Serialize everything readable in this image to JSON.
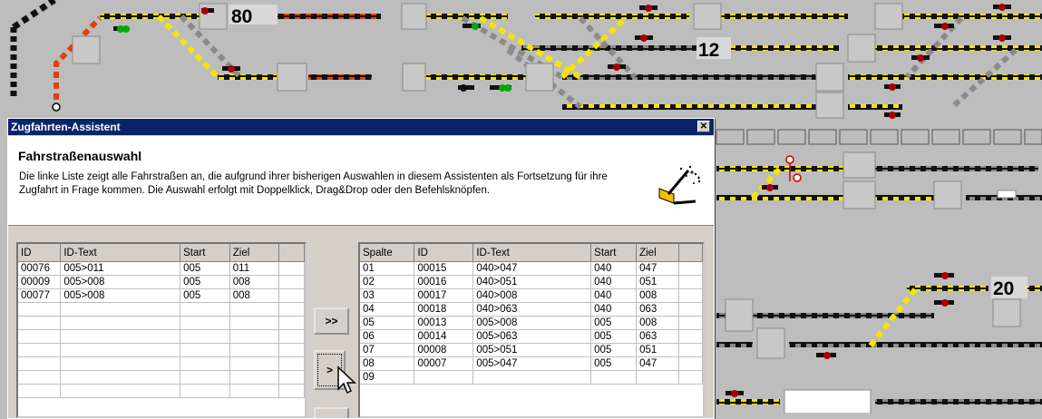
{
  "layout": {
    "signal_numbers": [
      "80",
      "12",
      "20"
    ]
  },
  "dialog": {
    "title": "Zugfahrten-Assistent",
    "close_label": "✕",
    "header_title": "Fahrstraßenauswahl",
    "header_description": "Die linke Liste zeigt alle Fahrstraßen an, die aufgrund ihrer bisherigen Auswahlen in diesem Assistenten als Fortsetzung für ihre Zugfahrt in Frage kommen. Die Auswahl erfolgt mit Doppelklick, Drag&Drop oder den Befehlsknöpfen.",
    "header_icon": "wizard-wand-icon",
    "left_list": {
      "columns": [
        "ID",
        "ID-Text",
        "Start",
        "Ziel"
      ],
      "rows": [
        [
          "00076",
          "005>011",
          "005",
          "011"
        ],
        [
          "00009",
          "005>008",
          "005",
          "008"
        ],
        [
          "00077",
          "005>008",
          "005",
          "008"
        ]
      ]
    },
    "right_list": {
      "columns": [
        "Spalte",
        "ID",
        "ID-Text",
        "Start",
        "Ziel"
      ],
      "rows": [
        [
          "01",
          "00015",
          "040>047",
          "040",
          "047"
        ],
        [
          "02",
          "00016",
          "040>051",
          "040",
          "051"
        ],
        [
          "03",
          "00017",
          "040>008",
          "040",
          "008"
        ],
        [
          "04",
          "00018",
          "040>063",
          "040",
          "063"
        ],
        [
          "05",
          "00013",
          "005>008",
          "005",
          "008"
        ],
        [
          "06",
          "00014",
          "005>063",
          "005",
          "063"
        ],
        [
          "07",
          "00008",
          "005>051",
          "005",
          "051"
        ],
        [
          "08",
          "00007",
          "005>047",
          "005",
          "047"
        ],
        [
          "09",
          "",
          "",
          "",
          ""
        ]
      ]
    },
    "buttons": {
      "add_all": ">>",
      "add_one": ">"
    }
  }
}
